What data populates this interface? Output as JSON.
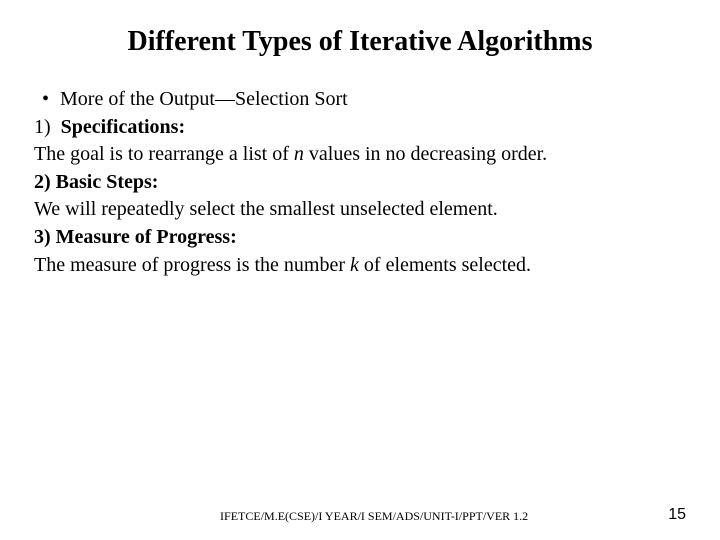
{
  "title": "Different Types of Iterative Algorithms",
  "bullet": {
    "mark": "•",
    "text": "More of the Output—Selection Sort"
  },
  "lines": {
    "spec_label_num": "1)",
    "spec_label": "Specifications:",
    "spec_text_a": "The goal is to rearrange a list of ",
    "spec_text_n": "n",
    "spec_text_b": " values in no decreasing order.",
    "steps_label_num": "2) ",
    "steps_label": "Basic Steps:",
    "steps_text": "We will repeatedly select the smallest unselected element.",
    "measure_label_num": "3) ",
    "measure_label": "Measure of Progress:",
    "measure_text_a": " The measure of progress is the number ",
    "measure_text_k": "k",
    "measure_text_b": " of elements selected."
  },
  "footer": {
    "path": "IFETCE/M.E(CSE)/I YEAR/I SEM/ADS/UNIT-I/PPT/VER 1.2",
    "page": "15"
  }
}
